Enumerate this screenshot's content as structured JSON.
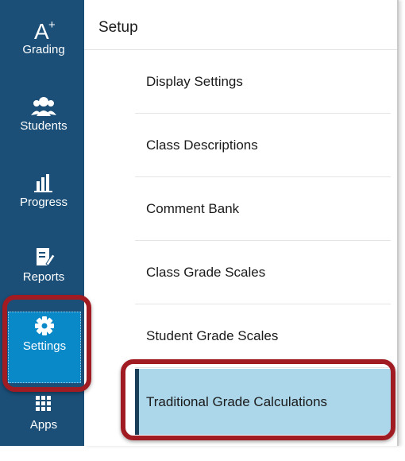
{
  "nav": {
    "items": [
      {
        "label": "Grading",
        "icon": "a-plus-icon"
      },
      {
        "label": "Students",
        "icon": "students-icon"
      },
      {
        "label": "Progress",
        "icon": "bar-chart-icon"
      },
      {
        "label": "Reports",
        "icon": "report-icon"
      },
      {
        "label": "Settings",
        "icon": "gear-icon",
        "active": true
      },
      {
        "label": "Apps",
        "icon": "grid-icon"
      }
    ]
  },
  "panel": {
    "title": "Setup",
    "items": [
      {
        "label": "Display Settings"
      },
      {
        "label": "Class Descriptions"
      },
      {
        "label": "Comment Bank"
      },
      {
        "label": "Class Grade Scales"
      },
      {
        "label": "Student Grade Scales"
      },
      {
        "label": "Traditional Grade Calculations",
        "selected": true
      }
    ]
  },
  "colors": {
    "nav_bg": "#1b4f78",
    "nav_active": "#0a89c9",
    "selected_bg": "#acd7ea",
    "highlight_ring": "#a01b22"
  }
}
